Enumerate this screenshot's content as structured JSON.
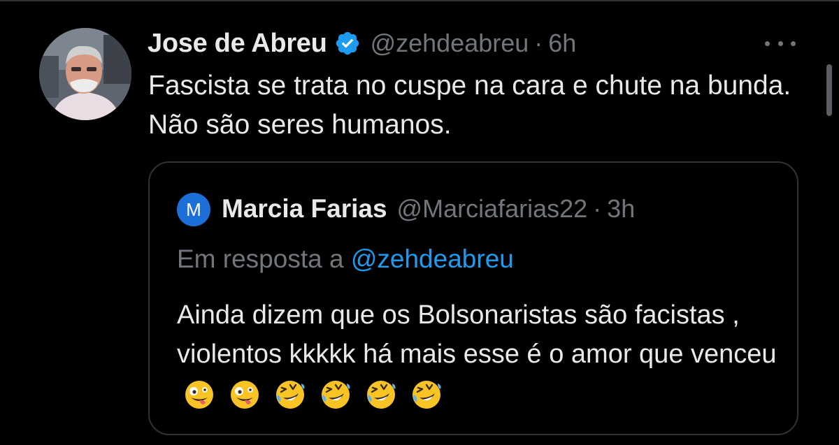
{
  "tweet": {
    "display_name": "Jose de Abreu",
    "handle": "@zehdeabreu",
    "separator": "·",
    "time": "6h",
    "text": "Fascista se trata no cuspe na cara e chute na bunda. Não são seres humanos.",
    "verified_icon": "verified-badge-icon",
    "more_icon": "more-options-icon"
  },
  "quote": {
    "avatar_letter": "M",
    "display_name": "Marcia Farias",
    "handle": "@Marciafarias22",
    "separator": "·",
    "time": "3h",
    "reply_prefix": "Em resposta a",
    "reply_mention": "@zehdeabreu",
    "text": "Ainda dizem que os Bolsonaristas são facistas , violentos kkkkk há mais esse é o amor que venceu",
    "emojis": [
      "zany-face",
      "zany-face",
      "rolling-laughing",
      "rolling-laughing",
      "rolling-laughing",
      "rolling-laughing"
    ]
  },
  "colors": {
    "background": "#000000",
    "text": "#e7e9ea",
    "secondary": "#71767b",
    "accent": "#1d9bf0",
    "border": "#2f3336"
  }
}
